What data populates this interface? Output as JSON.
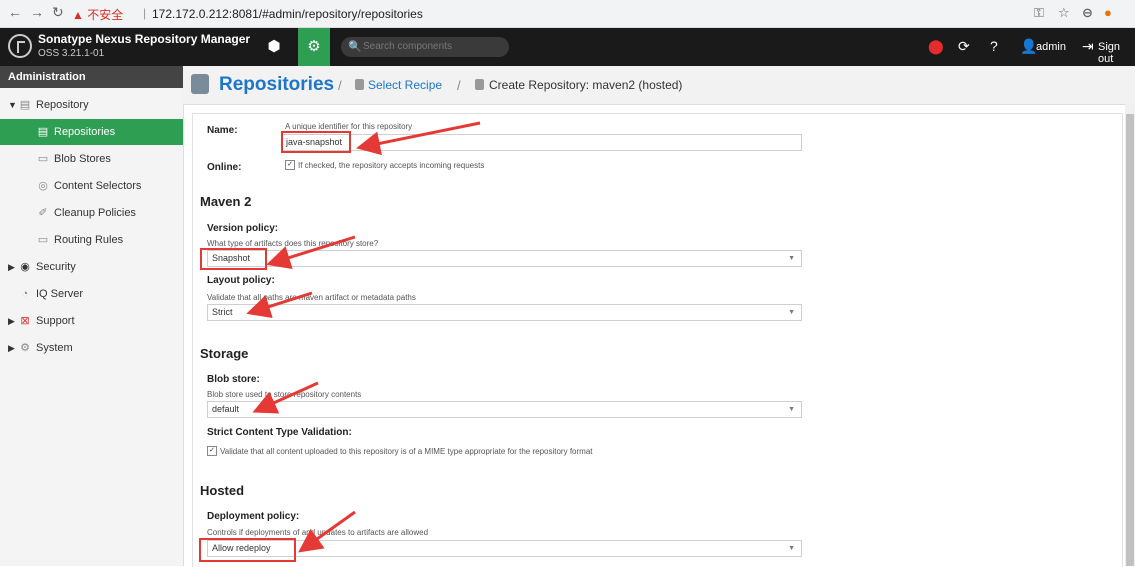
{
  "browser": {
    "security_warning": "不安全",
    "url": "172.172.0.212:8081/#admin/repository/repositories"
  },
  "header": {
    "title": "Sonatype Nexus Repository Manager",
    "version": "OSS 3.21.1-01",
    "search_placeholder": "Search components",
    "user": "admin",
    "sign_out": "Sign out"
  },
  "sidebar": {
    "heading": "Administration",
    "items": [
      {
        "label": "Repository",
        "icon": "database-icon"
      },
      {
        "label": "Repositories",
        "icon": "database-icon"
      },
      {
        "label": "Blob Stores",
        "icon": "server-icon"
      },
      {
        "label": "Content Selectors",
        "icon": "layers-icon"
      },
      {
        "label": "Cleanup Policies",
        "icon": "brush-icon"
      },
      {
        "label": "Routing Rules",
        "icon": "route-icon"
      },
      {
        "label": "Security",
        "icon": "eye-icon"
      },
      {
        "label": "IQ Server",
        "icon": "iq-icon"
      },
      {
        "label": "Support",
        "icon": "support-icon"
      },
      {
        "label": "System",
        "icon": "gear-icon"
      }
    ]
  },
  "breadcrumb": {
    "title": "Repositories",
    "select_recipe": "Select Recipe",
    "current": "Create Repository: maven2 (hosted)"
  },
  "form": {
    "name_label": "Name:",
    "name_help": "A unique identifier for this repository",
    "name_value": "java-snapshot",
    "online_label": "Online:",
    "online_help": "If checked, the repository accepts incoming requests",
    "maven_section": "Maven 2",
    "version_label": "Version policy:",
    "version_help": "What type of artifacts does this repository store?",
    "version_value": "Snapshot",
    "layout_label": "Layout policy:",
    "layout_help": "Validate that all paths are maven artifact or metadata paths",
    "layout_value": "Strict",
    "storage_section": "Storage",
    "blob_label": "Blob store:",
    "blob_help": "Blob store used to store repository contents",
    "blob_value": "default",
    "strict_label": "Strict Content Type Validation:",
    "strict_help": "Validate that all content uploaded to this repository is of a MIME type appropriate for the repository format",
    "hosted_section": "Hosted",
    "deploy_label": "Deployment policy:",
    "deploy_help": "Controls if deployments of and updates to artifacts are allowed",
    "deploy_value": "Allow redeploy"
  },
  "colors": {
    "accent_green": "#2e9e52",
    "link_blue": "#1e76c9",
    "annotation_red": "#e53935"
  }
}
